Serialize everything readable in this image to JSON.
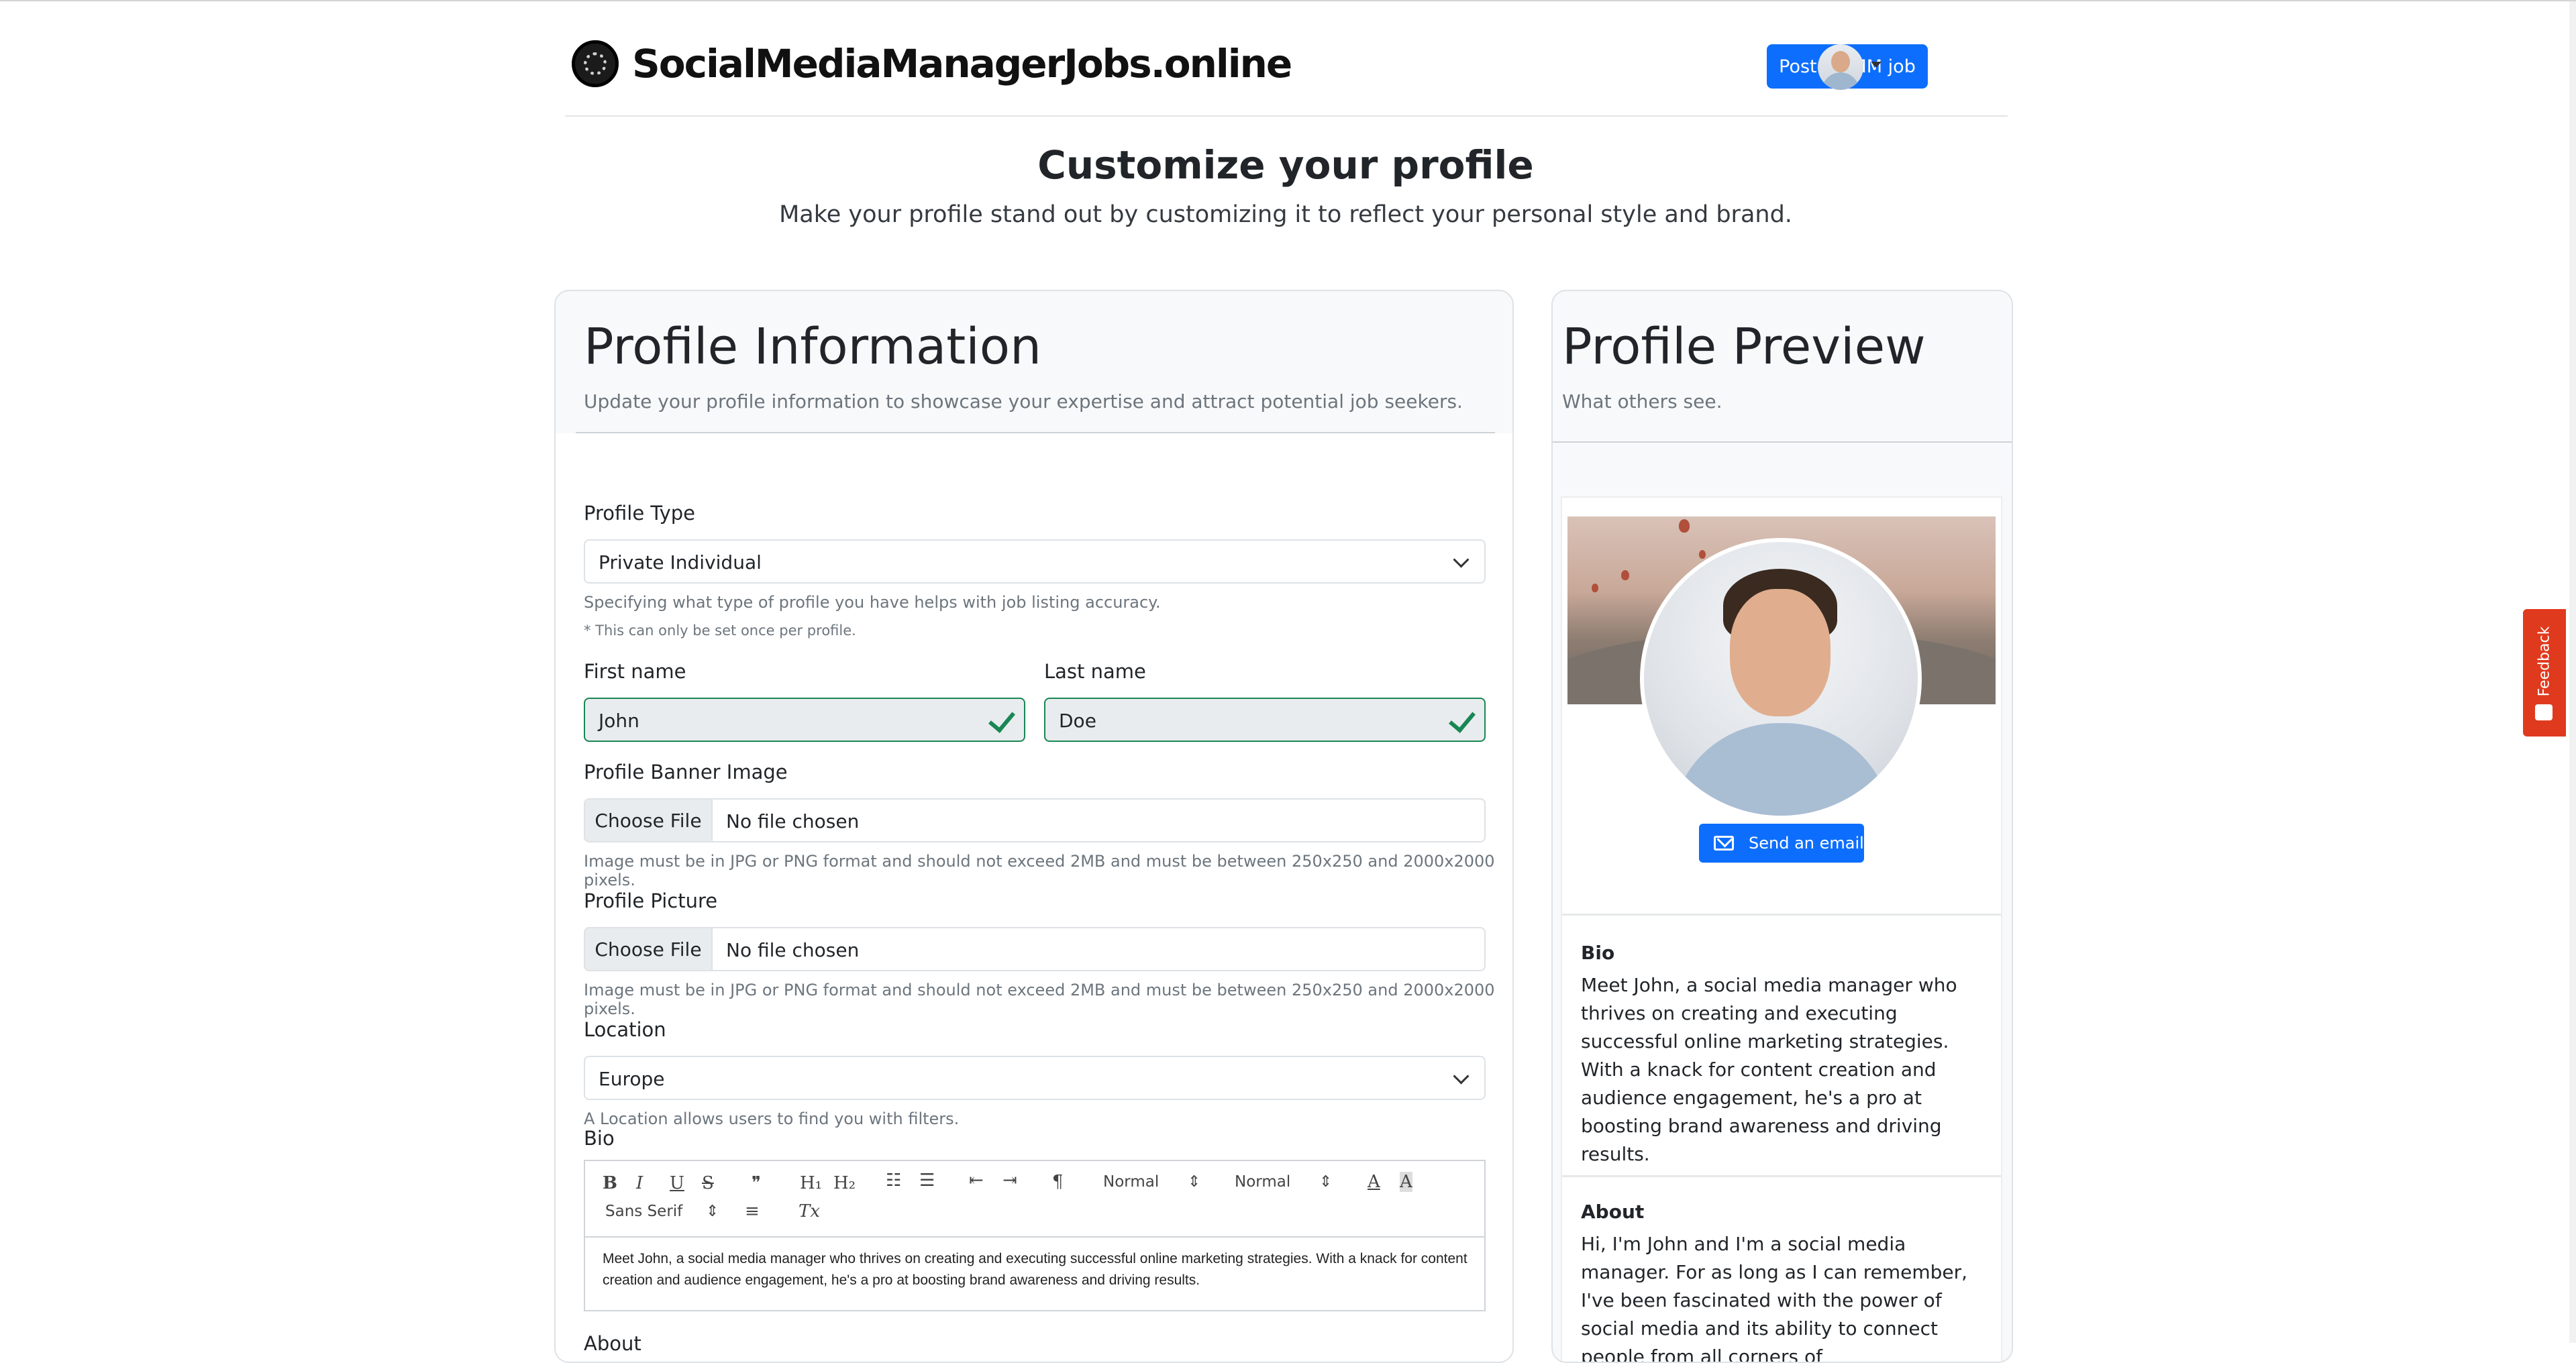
{
  "header": {
    "logo_text": "SocialMediaManagerJobs.online",
    "post_button": "Post a SMM job"
  },
  "page": {
    "title": "Customize your profile",
    "subtitle": "Make your profile stand out by customizing it to reflect your personal style and brand."
  },
  "profile_info": {
    "heading": "Profile Information",
    "subtitle": "Update your profile information to showcase your expertise and attract potential job seekers.",
    "profile_type": {
      "label": "Profile Type",
      "value": "Private Individual",
      "hint": "Specifying what type of profile you have helps with job listing accuracy.",
      "note": "* This can only be set once per profile."
    },
    "first_name": {
      "label": "First name",
      "value": "John"
    },
    "last_name": {
      "label": "Last name",
      "value": "Doe"
    },
    "banner_image": {
      "label": "Profile Banner Image",
      "button": "Choose File",
      "status": "No file chosen",
      "hint": "Image must be in JPG or PNG format and should not exceed 2MB and must be between 250x250 and 2000x2000 pixels."
    },
    "profile_picture": {
      "label": "Profile Picture",
      "button": "Choose File",
      "status": "No file chosen",
      "hint": "Image must be in JPG or PNG format and should not exceed 2MB and must be between 250x250 and 2000x2000 pixels."
    },
    "location": {
      "label": "Location",
      "value": "Europe",
      "hint": "A Location allows users to find you with filters."
    },
    "bio": {
      "label": "Bio",
      "toolbar": {
        "bold": "B",
        "italic": "I",
        "underline": "U",
        "strike": "S",
        "quote": "❞",
        "h1": "H₁",
        "h2": "H₂",
        "size": "Normal",
        "header": "Normal",
        "font": "Sans Serif",
        "clean": "Tx"
      },
      "text": "Meet John, a social media manager who thrives on creating and executing successful online marketing strategies. With a knack for content creation and audience engagement, he's a pro at boosting brand awareness and driving results."
    },
    "about_label": "About"
  },
  "preview": {
    "heading": "Profile Preview",
    "subtitle": "What others see.",
    "email_button": "Send an email",
    "bio_heading": "Bio",
    "bio_text": "Meet John, a social media manager who thrives on creating and executing successful online marketing strategies. With a knack for content creation and audience engagement, he's a pro at boosting brand awareness and driving results.",
    "about_heading": "About",
    "about_text": "Hi, I'm John and I'm a social media manager. For as long as I can remember, I've been fascinated with the power of social media and its ability to connect people from all corners of"
  },
  "feedback_tab": "Feedback",
  "colors": {
    "primary": "#0d6efd",
    "success": "#198754",
    "feedback": "#e03a1e"
  }
}
